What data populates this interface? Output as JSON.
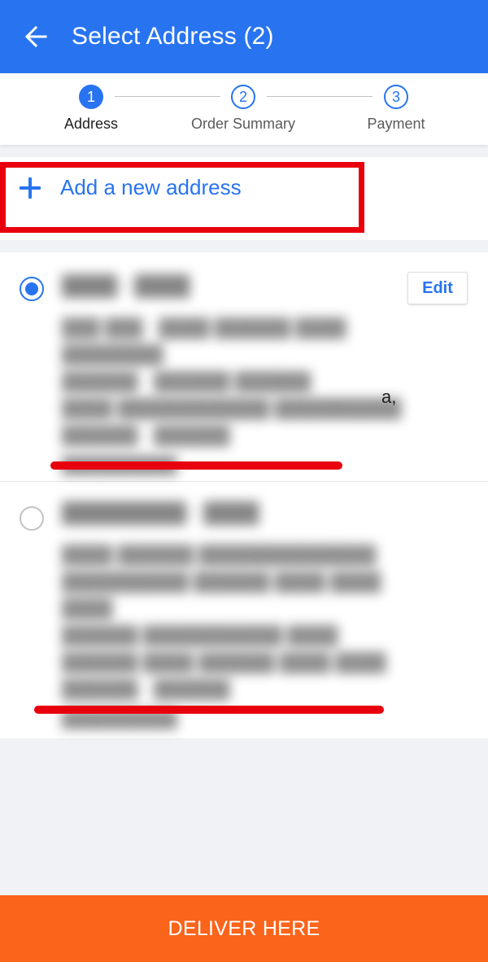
{
  "header": {
    "title": "Select Address (2)",
    "back_icon": "arrow-left-icon",
    "color": "#2874f0"
  },
  "stepper": {
    "steps": [
      {
        "number": "1",
        "label": "Address",
        "active": true
      },
      {
        "number": "2",
        "label": "Order Summary",
        "active": false
      },
      {
        "number": "3",
        "label": "Payment",
        "active": false
      }
    ]
  },
  "add_address": {
    "label": "Add a new address",
    "icon": "plus-icon"
  },
  "addresses": [
    {
      "selected": true,
      "name": "████ · ████",
      "lines": [
        "███ ███ · ████ ██████ ████ ████████",
        "██████ · ██████ ██████",
        "████ ████████████ ██████████",
        "██████ · ██████"
      ],
      "phone": "██████████",
      "edit_label": "Edit"
    },
    {
      "selected": false,
      "name": "█████████ · ████",
      "lines": [
        "████ ██████ ██████████████",
        "██████████ ██████ ████ ████ ████",
        "██████ ███████████ ████",
        "██████ ████ ██████ ████ ████"
      ],
      "line_suffix": "a,",
      "extra_line": "██████ · ██████",
      "phone": "██████████"
    }
  ],
  "cta": {
    "label": "DELIVER HERE",
    "color": "#fb641b"
  },
  "annotation_color": "#e8000d"
}
